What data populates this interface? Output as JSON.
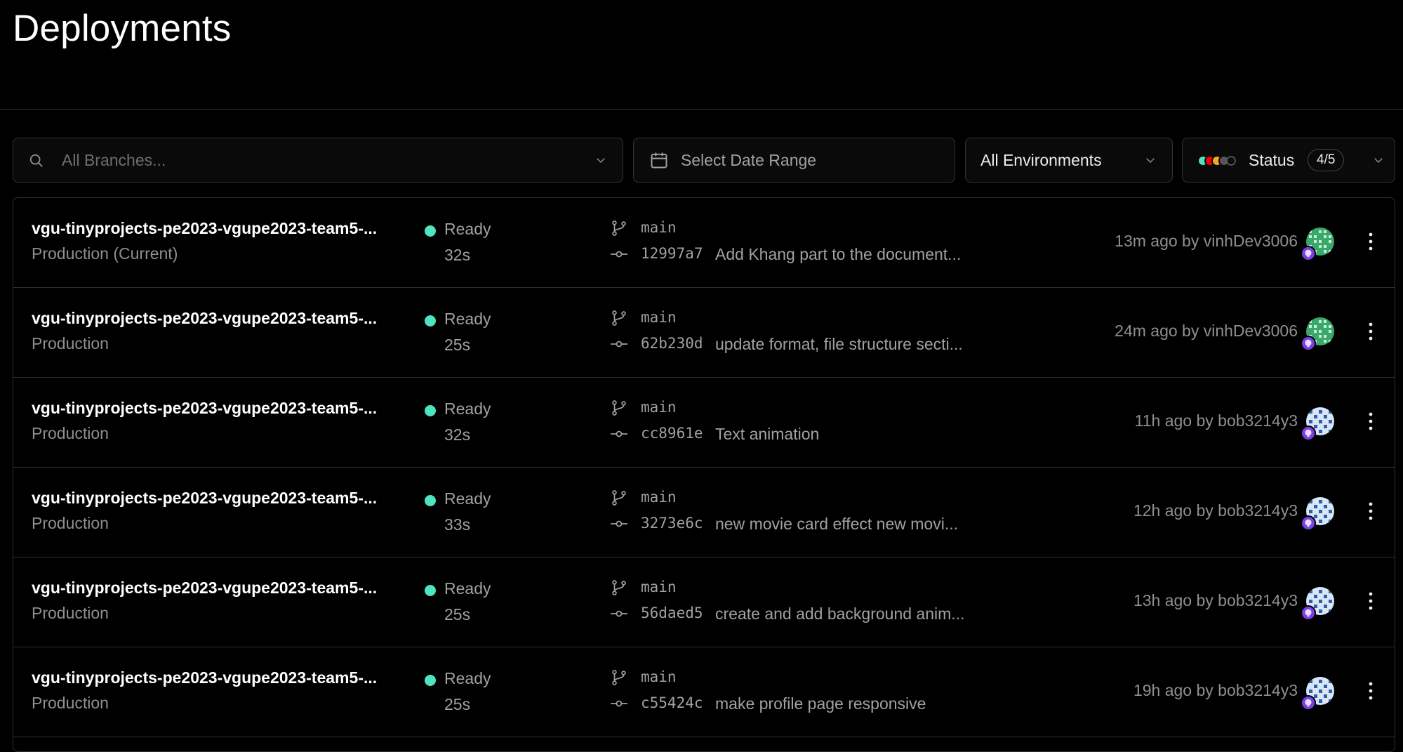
{
  "header": {
    "title": "Deployments"
  },
  "filters": {
    "branches_placeholder": "All Branches...",
    "date_range_label": "Select Date Range",
    "environments_label": "All Environments",
    "status_label": "Status",
    "status_count": "4/5"
  },
  "colors": {
    "ready": "#50e3c2",
    "status_dots": [
      "#50e3c2",
      "#ee0000",
      "#f5a623",
      "#666666",
      "#333333"
    ]
  },
  "deployments": [
    {
      "project": "vgu-tinyprojects-pe2023-vgupe2023-team5-...",
      "environment": "Production (Current)",
      "status": "Ready",
      "duration": "32s",
      "branch": "main",
      "sha": "12997a7",
      "message": "Add Khang part to the document...",
      "meta": "13m ago by vinhDev3006",
      "avatar": "green-identicon"
    },
    {
      "project": "vgu-tinyprojects-pe2023-vgupe2023-team5-...",
      "environment": "Production",
      "status": "Ready",
      "duration": "25s",
      "branch": "main",
      "sha": "62b230d",
      "message": "update format, file structure secti...",
      "meta": "24m ago by vinhDev3006",
      "avatar": "green-identicon"
    },
    {
      "project": "vgu-tinyprojects-pe2023-vgupe2023-team5-...",
      "environment": "Production",
      "status": "Ready",
      "duration": "32s",
      "branch": "main",
      "sha": "cc8961e",
      "message": "Text animation",
      "meta": "11h ago by bob3214y3",
      "avatar": "blue-identicon"
    },
    {
      "project": "vgu-tinyprojects-pe2023-vgupe2023-team5-...",
      "environment": "Production",
      "status": "Ready",
      "duration": "33s",
      "branch": "main",
      "sha": "3273e6c",
      "message": "new movie card effect new movi...",
      "meta": "12h ago by bob3214y3",
      "avatar": "blue-identicon"
    },
    {
      "project": "vgu-tinyprojects-pe2023-vgupe2023-team5-...",
      "environment": "Production",
      "status": "Ready",
      "duration": "25s",
      "branch": "main",
      "sha": "56daed5",
      "message": "create and add background anim...",
      "meta": "13h ago by bob3214y3",
      "avatar": "blue-identicon"
    },
    {
      "project": "vgu-tinyprojects-pe2023-vgupe2023-team5-...",
      "environment": "Production",
      "status": "Ready",
      "duration": "25s",
      "branch": "main",
      "sha": "c55424c",
      "message": "make profile page responsive",
      "meta": "19h ago by bob3214y3",
      "avatar": "blue-identicon"
    }
  ]
}
